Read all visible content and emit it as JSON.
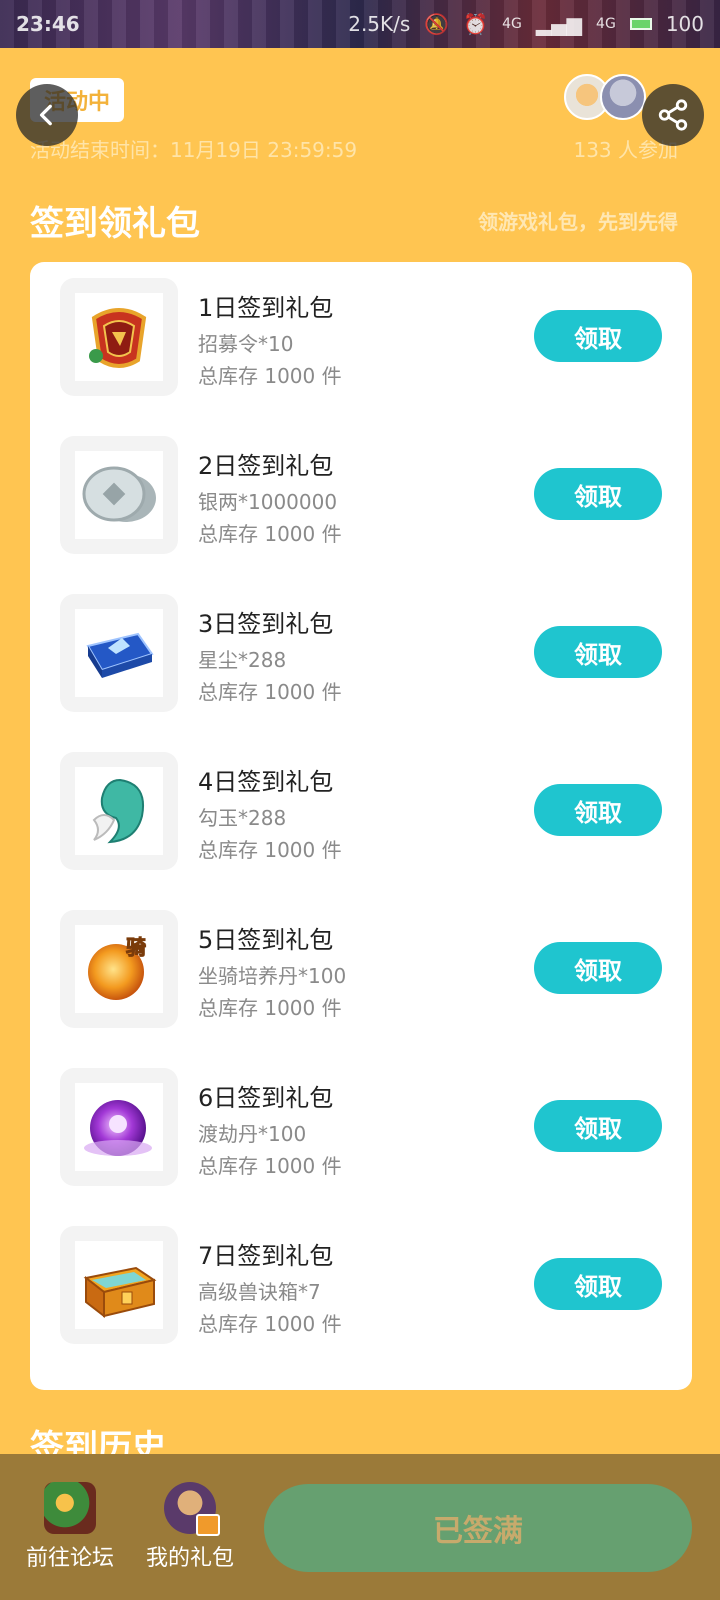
{
  "status_bar": {
    "time": "23:46",
    "speed": "2.5K/s",
    "network1": "4G",
    "network2": "4G",
    "battery": "100"
  },
  "header": {
    "badge": "活动中",
    "end_time": "活动结束时间：11月19日 23:59:59",
    "participants": "133 人参加"
  },
  "section": {
    "title": "签到领礼包",
    "subtitle": "领游戏礼包，先到先得"
  },
  "gifts": [
    {
      "title": "1日签到礼包",
      "content": "招募令*10",
      "stock": "总库存 1000 件",
      "button": "领取",
      "icon": "recruit-token-icon"
    },
    {
      "title": "2日签到礼包",
      "content": "银两*1000000",
      "stock": "总库存 1000 件",
      "button": "领取",
      "icon": "silver-coin-icon"
    },
    {
      "title": "3日签到礼包",
      "content": "星尘*288",
      "stock": "总库存 1000 件",
      "button": "领取",
      "icon": "stardust-chest-icon"
    },
    {
      "title": "4日签到礼包",
      "content": "勾玉*288",
      "stock": "总库存 1000 件",
      "button": "领取",
      "icon": "magatama-icon"
    },
    {
      "title": "5日签到礼包",
      "content": "坐骑培养丹*100",
      "stock": "总库存 1000 件",
      "button": "领取",
      "icon": "mount-pill-icon",
      "icon_label": "骑"
    },
    {
      "title": "6日签到礼包",
      "content": "渡劫丹*100",
      "stock": "总库存 1000 件",
      "button": "领取",
      "icon": "tribulation-pill-icon"
    },
    {
      "title": "7日签到礼包",
      "content": "高级兽诀箱*7",
      "stock": "总库存 1000 件",
      "button": "领取",
      "icon": "treasure-chest-icon"
    }
  ],
  "history_title": "签到历史",
  "bottom_bar": {
    "forum_label": "前往论坛",
    "mygift_label": "我的礼包",
    "signed_label": "已签满"
  },
  "colors": {
    "background": "#ffc551",
    "claim_button": "#1fc5cf",
    "signed_button": "#66a070",
    "bottom_bar": "#9b7a39"
  }
}
